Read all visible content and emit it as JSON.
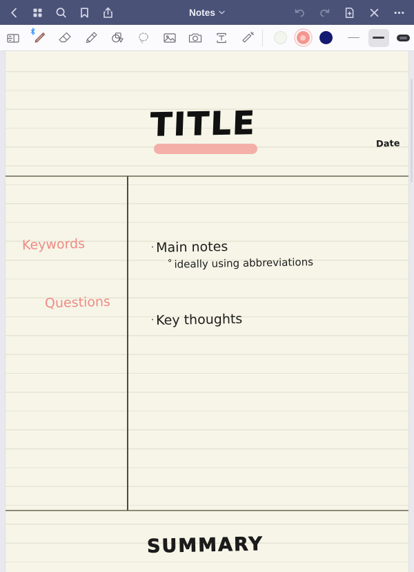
{
  "topbar": {
    "background_color": "#4a5278",
    "title": "Notes",
    "title_caret": "⌄",
    "left_icons": [
      {
        "name": "back-icon",
        "label": "Back"
      },
      {
        "name": "grid-icon",
        "label": "Page grid"
      },
      {
        "name": "search-icon",
        "label": "Search"
      },
      {
        "name": "bookmark-icon",
        "label": "Bookmark"
      },
      {
        "name": "share-icon",
        "label": "Share"
      }
    ],
    "right_icons": [
      {
        "name": "undo-icon",
        "label": "Undo",
        "enabled": false
      },
      {
        "name": "redo-icon",
        "label": "Redo",
        "enabled": false
      },
      {
        "name": "add-page-icon",
        "label": "Add page",
        "enabled": true
      },
      {
        "name": "close-icon",
        "label": "Close",
        "enabled": true
      },
      {
        "name": "more-icon",
        "label": "More",
        "enabled": true
      }
    ]
  },
  "toolbar": {
    "background_color": "#fbfbfd",
    "tools": [
      {
        "name": "text-box-tool",
        "label": "Text box"
      },
      {
        "name": "pen-tool",
        "label": "Pen",
        "selected": true,
        "bluetooth_badge": "ᛦ"
      },
      {
        "name": "eraser-tool",
        "label": "Eraser"
      },
      {
        "name": "highlighter-tool",
        "label": "Highlighter"
      },
      {
        "name": "shapes-tool",
        "label": "Shapes"
      },
      {
        "name": "lasso-tool",
        "label": "Lasso select"
      },
      {
        "name": "image-tool",
        "label": "Insert image"
      },
      {
        "name": "camera-tool",
        "label": "Camera"
      },
      {
        "name": "text-tool",
        "label": "Text"
      },
      {
        "name": "laser-tool",
        "label": "Laser pointer"
      }
    ],
    "colors": [
      {
        "name": "color-swatch-white",
        "hex": "#f2f6ee",
        "selected": false
      },
      {
        "name": "color-swatch-salmon",
        "hex": "#f4968f",
        "selected": true
      },
      {
        "name": "color-swatch-navy",
        "hex": "#141a72",
        "selected": false
      }
    ],
    "strokes": [
      {
        "name": "stroke-thin",
        "label": "Thin",
        "selected": false
      },
      {
        "name": "stroke-thick",
        "label": "Thick",
        "selected": true
      },
      {
        "name": "stroke-pill",
        "label": "Extra thick",
        "selected": false
      }
    ]
  },
  "page": {
    "background_color": "#f6f5e8",
    "rule_color": "#e6e4d2",
    "title": "TITLE",
    "title_highlight_color": "#f3aba4",
    "date_label": "Date",
    "left_column": {
      "keywords_label": "Keywords",
      "keywords_color": "#ef8a84",
      "questions_label": "Questions",
      "questions_color": "#ef8a84"
    },
    "right_column": {
      "bullet": "·",
      "sub_bullet": "°",
      "main_note": "Main notes",
      "sub_note": "ideally using abbreviations",
      "key_note": "Key thoughts"
    },
    "summary_label": "SUMMARY"
  }
}
